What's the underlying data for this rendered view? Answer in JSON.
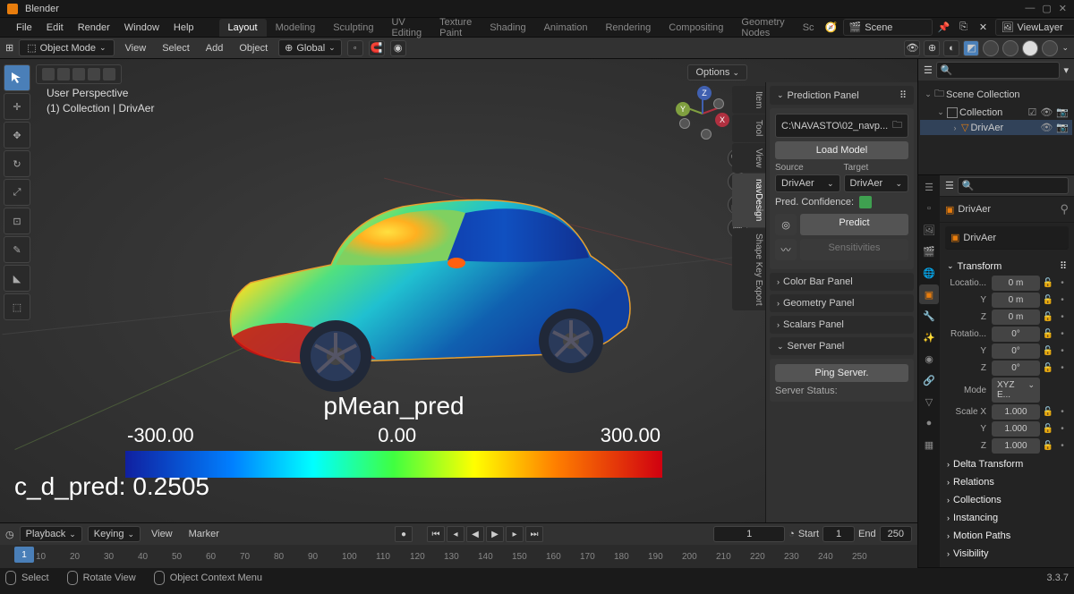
{
  "app": {
    "title": "Blender",
    "version": "3.3.7"
  },
  "menubar": [
    "File",
    "Edit",
    "Render",
    "Window",
    "Help"
  ],
  "workspaces": {
    "active": "Layout",
    "tabs": [
      "Layout",
      "Modeling",
      "Sculpting",
      "UV Editing",
      "Texture Paint",
      "Shading",
      "Animation",
      "Rendering",
      "Compositing",
      "Geometry Nodes",
      "Sc"
    ]
  },
  "scene": {
    "name": "Scene",
    "viewlayer": "ViewLayer"
  },
  "toolbar": {
    "mode": "Object Mode",
    "menus": [
      "View",
      "Select",
      "Add",
      "Object"
    ],
    "orient": "Global",
    "options": "Options"
  },
  "perspective": {
    "line1": "User Perspective",
    "line2": "(1) Collection | DrivAer"
  },
  "gizmo": {
    "x": "X",
    "y": "Y",
    "z": "Z"
  },
  "npanel": {
    "prediction": {
      "title": "Prediction Panel",
      "path": "C:\\NAVASTO\\02_navp...",
      "load": "Load Model",
      "source_label": "Source",
      "target_label": "Target",
      "source": "DrivAer",
      "target": "DrivAer",
      "conf_label": "Pred. Confidence:",
      "predict": "Predict",
      "sensitivities": "Sensitivities"
    },
    "panels": [
      "Color Bar Panel",
      "Geometry Panel",
      "Scalars Panel"
    ],
    "server": {
      "title": "Server Panel",
      "ping": "Ping Server.",
      "status": "Server Status:"
    }
  },
  "side_tabs": [
    "Item",
    "Tool",
    "View",
    "navDesign",
    "Shape Key Export"
  ],
  "colorbar": {
    "title": "pMean_pred",
    "min": "-300.00",
    "mid": "0.00",
    "max": "300.00"
  },
  "cd_pred": "c_d_pred: 0.2505",
  "timeline": {
    "playback": "Playback",
    "keying": "Keying",
    "view": "View",
    "marker": "Marker",
    "current": "1",
    "start_label": "Start",
    "start": "1",
    "end_label": "End",
    "end": "250",
    "ticks": [
      "10",
      "20",
      "30",
      "40",
      "50",
      "60",
      "70",
      "80",
      "90",
      "100",
      "110",
      "120",
      "130",
      "140",
      "150",
      "160",
      "170",
      "180",
      "190",
      "200",
      "210",
      "220",
      "230",
      "240",
      "250"
    ],
    "cursor": "1"
  },
  "outliner": {
    "scene": "Scene Collection",
    "collection": "Collection",
    "object": "DrivAer"
  },
  "properties": {
    "crumb1": "DrivAer",
    "crumb2": "DrivAer",
    "transform": {
      "title": "Transform",
      "location": {
        "label": "Locatio...",
        "x": "0 m",
        "y": "0 m",
        "z": "0 m",
        "y_label": "Y",
        "z_label": "Z"
      },
      "rotation": {
        "label": "Rotatio...",
        "x": "0°",
        "y": "0°",
        "z": "0°",
        "y_label": "Y",
        "z_label": "Z",
        "mode_label": "Mode",
        "mode": "XYZ E..."
      },
      "scale": {
        "label": "Scale X",
        "x": "1.000",
        "y": "1.000",
        "z": "1.000",
        "y_label": "Y",
        "z_label": "Z"
      }
    },
    "sections": [
      "Delta Transform",
      "Relations",
      "Collections",
      "Instancing",
      "Motion Paths",
      "Visibility"
    ]
  },
  "status": {
    "select": "Select",
    "rotate": "Rotate View",
    "context": "Object Context Menu"
  }
}
